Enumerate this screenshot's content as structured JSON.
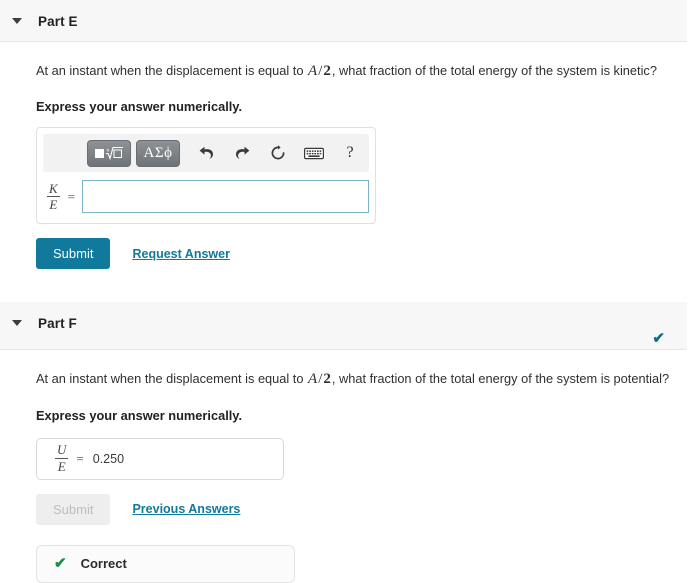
{
  "parts": [
    {
      "id": "part-e",
      "title": "Part E",
      "caret_icon": "chevron-down-icon",
      "question_prefix": "At an instant when the displacement is equal to ",
      "question_math_numerator": "A",
      "question_math_slash": "/",
      "question_math_denominator": "2",
      "question_suffix": ", what fraction of the total energy of the system is kinetic?",
      "instruction": "Express your answer numerically.",
      "answered": false,
      "status_check_icon": "",
      "toolbar": {
        "template_button_label": "■√□",
        "template_button_icon": "math-template-icon",
        "greek_button_label": "ΑΣϕ",
        "greek_button_icon": "greek-letters-icon",
        "undo_icon": "undo-icon",
        "redo_icon": "redo-icon",
        "reset_icon": "reset-icon",
        "keyboard_icon": "keyboard-icon",
        "help_icon": "help-icon",
        "help_label": "?"
      },
      "answer": {
        "fraction_numerator": "K",
        "fraction_denominator": "E",
        "equals": "=",
        "value": "",
        "placeholder": ""
      },
      "submit_label": "Submit",
      "submit_disabled": false,
      "secondary_link": "Request Answer",
      "feedback": null
    },
    {
      "id": "part-f",
      "title": "Part F",
      "caret_icon": "chevron-down-icon",
      "question_prefix": "At an instant when the displacement is equal to ",
      "question_math_numerator": "A",
      "question_math_slash": "/",
      "question_math_denominator": "2",
      "question_suffix": ", what fraction of the total energy of the system is potential?",
      "instruction": "Express your answer numerically.",
      "answered": true,
      "status_check_icon": "check-icon",
      "status_check_glyph": "✔",
      "answer": {
        "fraction_numerator": "U",
        "fraction_denominator": "E",
        "equals": "=",
        "value": "0.250",
        "placeholder": ""
      },
      "submit_label": "Submit",
      "submit_disabled": true,
      "secondary_link": "Previous Answers",
      "feedback": {
        "icon": "check-icon",
        "glyph": "✔",
        "label": "Correct"
      }
    }
  ],
  "colors": {
    "accent_teal": "#11799b",
    "band_gray": "#f7f7f7",
    "correct_green": "#159245",
    "input_border": "#7cb3c9"
  }
}
